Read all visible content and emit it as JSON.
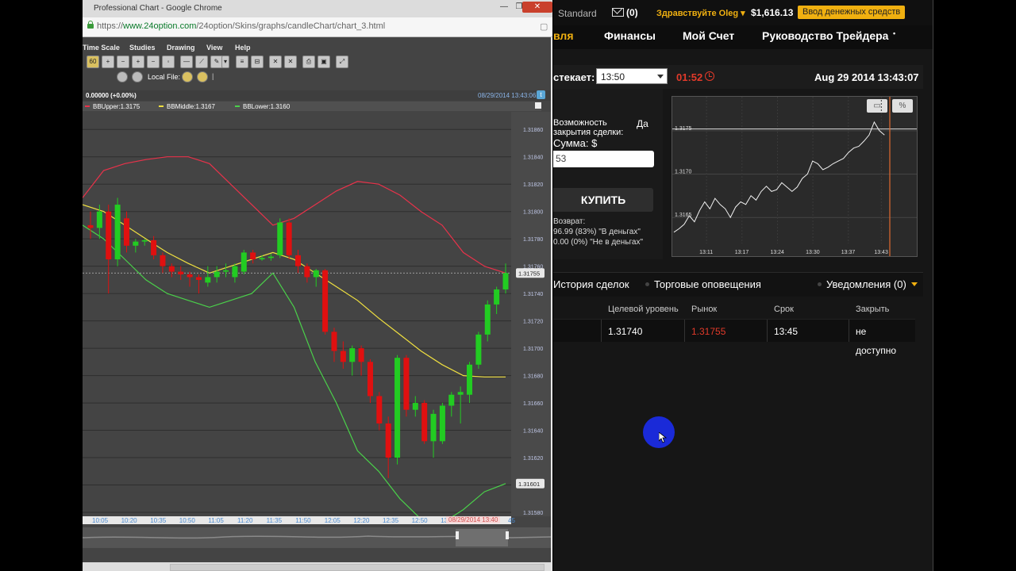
{
  "chrome": {
    "window_title": "Professional Chart - Google Chrome",
    "url_scheme": "https://",
    "url_host": "www.24option.com",
    "url_path": "/24option/Skins/graphs/candleChart/chart_3.html",
    "minimize": "—",
    "maximize": "❐",
    "close": "✕"
  },
  "chart_app": {
    "menu": [
      "Time Scale",
      "Studies",
      "Drawing",
      "View",
      "Help"
    ],
    "timeframe_button": "60",
    "local_file_label": "Local File:",
    "price_change": "0.00000 (+0.00%)",
    "timestamp": "08/29/2014 13:43:06",
    "legend": [
      {
        "label": "BBUpper:1.3175",
        "color": "#e8324a"
      },
      {
        "label": "BBMiddle:1.3167",
        "color": "#f0e040"
      },
      {
        "label": "BBLower:1.3160",
        "color": "#4ad04a"
      }
    ],
    "time_labels": [
      "10:05",
      "10:20",
      "10:35",
      "10:50",
      "11:05",
      "11:20",
      "11:35",
      "11:50",
      "12:05",
      "12:20",
      "12:35",
      "12:50",
      "13"
    ],
    "time_cursor_label": "08/29/2014 13:40",
    "time_tail": "45"
  },
  "chart_data": {
    "type": "candlestick",
    "y_tick_labels": [
      "1.31860",
      "1.31840",
      "1.31820",
      "1.31800",
      "1.31780",
      "1.31760",
      "1.31740",
      "1.31720",
      "1.31700",
      "1.31680",
      "1.31660",
      "1.31640",
      "1.31620",
      "1.31600",
      "1.31580"
    ],
    "ylim": [
      1.3158,
      1.3187
    ],
    "current_price_label": "1.31755",
    "lower_band_label": "1.31601",
    "current_price": 1.31755,
    "candles": [
      {
        "o": 1.3179,
        "h": 1.318,
        "l": 1.3178,
        "c": 1.31788
      },
      {
        "o": 1.31788,
        "h": 1.31805,
        "l": 1.3178,
        "c": 1.318
      },
      {
        "o": 1.318,
        "h": 1.31805,
        "l": 1.3174,
        "c": 1.31765
      },
      {
        "o": 1.31765,
        "h": 1.3181,
        "l": 1.3176,
        "c": 1.31805
      },
      {
        "o": 1.31795,
        "h": 1.318,
        "l": 1.3177,
        "c": 1.31775
      },
      {
        "o": 1.31775,
        "h": 1.3178,
        "l": 1.3177,
        "c": 1.31778
      },
      {
        "o": 1.31778,
        "h": 1.3178,
        "l": 1.31775,
        "c": 1.31779
      },
      {
        "o": 1.31779,
        "h": 1.31782,
        "l": 1.31765,
        "c": 1.31768
      },
      {
        "o": 1.31768,
        "h": 1.3177,
        "l": 1.31755,
        "c": 1.3176
      },
      {
        "o": 1.3176,
        "h": 1.31762,
        "l": 1.31752,
        "c": 1.31756
      },
      {
        "o": 1.31756,
        "h": 1.3176,
        "l": 1.3175,
        "c": 1.31754
      },
      {
        "o": 1.31754,
        "h": 1.31756,
        "l": 1.31745,
        "c": 1.31752
      },
      {
        "o": 1.31752,
        "h": 1.31754,
        "l": 1.3174,
        "c": 1.3175
      },
      {
        "o": 1.31748,
        "h": 1.3176,
        "l": 1.31745,
        "c": 1.31752
      },
      {
        "o": 1.31752,
        "h": 1.3176,
        "l": 1.31748,
        "c": 1.31756
      },
      {
        "o": 1.31756,
        "h": 1.31762,
        "l": 1.31752,
        "c": 1.31757
      },
      {
        "o": 1.31752,
        "h": 1.31762,
        "l": 1.31748,
        "c": 1.3176
      },
      {
        "o": 1.31756,
        "h": 1.31772,
        "l": 1.31754,
        "c": 1.3177
      },
      {
        "o": 1.3177,
        "h": 1.31772,
        "l": 1.31762,
        "c": 1.31765
      },
      {
        "o": 1.31765,
        "h": 1.31768,
        "l": 1.31764,
        "c": 1.31766
      },
      {
        "o": 1.31766,
        "h": 1.31769,
        "l": 1.31764,
        "c": 1.31767
      },
      {
        "o": 1.31768,
        "h": 1.31795,
        "l": 1.31766,
        "c": 1.31792
      },
      {
        "o": 1.31792,
        "h": 1.31795,
        "l": 1.31765,
        "c": 1.31768
      },
      {
        "o": 1.31768,
        "h": 1.31772,
        "l": 1.31755,
        "c": 1.3176
      },
      {
        "o": 1.3176,
        "h": 1.31762,
        "l": 1.31748,
        "c": 1.31752
      },
      {
        "o": 1.31752,
        "h": 1.31758,
        "l": 1.31745,
        "c": 1.31757
      },
      {
        "o": 1.31757,
        "h": 1.31758,
        "l": 1.3171,
        "c": 1.31712
      },
      {
        "o": 1.31712,
        "h": 1.31715,
        "l": 1.3169,
        "c": 1.31698
      },
      {
        "o": 1.31698,
        "h": 1.31705,
        "l": 1.31685,
        "c": 1.3169
      },
      {
        "o": 1.3169,
        "h": 1.31702,
        "l": 1.3168,
        "c": 1.317
      },
      {
        "o": 1.317,
        "h": 1.31702,
        "l": 1.3168,
        "c": 1.3169
      },
      {
        "o": 1.3169,
        "h": 1.31692,
        "l": 1.3166,
        "c": 1.31665
      },
      {
        "o": 1.31665,
        "h": 1.31668,
        "l": 1.3164,
        "c": 1.31645
      },
      {
        "o": 1.31645,
        "h": 1.3165,
        "l": 1.31605,
        "c": 1.3162
      },
      {
        "o": 1.3162,
        "h": 1.31695,
        "l": 1.31615,
        "c": 1.31693
      },
      {
        "o": 1.31693,
        "h": 1.31695,
        "l": 1.3165,
        "c": 1.31655
      },
      {
        "o": 1.31655,
        "h": 1.31665,
        "l": 1.3165,
        "c": 1.3166
      },
      {
        "o": 1.3166,
        "h": 1.31662,
        "l": 1.3163,
        "c": 1.31632
      },
      {
        "o": 1.31632,
        "h": 1.31655,
        "l": 1.3162,
        "c": 1.31652
      },
      {
        "o": 1.31632,
        "h": 1.3166,
        "l": 1.3163,
        "c": 1.31658
      },
      {
        "o": 1.31658,
        "h": 1.31668,
        "l": 1.3165,
        "c": 1.31666
      },
      {
        "o": 1.31666,
        "h": 1.31672,
        "l": 1.31645,
        "c": 1.31668
      },
      {
        "o": 1.31666,
        "h": 1.3169,
        "l": 1.3166,
        "c": 1.31688
      },
      {
        "o": 1.31688,
        "h": 1.31712,
        "l": 1.31685,
        "c": 1.3171
      },
      {
        "o": 1.3171,
        "h": 1.31735,
        "l": 1.31705,
        "c": 1.31732
      },
      {
        "o": 1.31732,
        "h": 1.31745,
        "l": 1.31725,
        "c": 1.31743
      },
      {
        "o": 1.31743,
        "h": 1.31762,
        "l": 1.3174,
        "c": 1.31755
      }
    ],
    "bb_upper": [
      1.3181,
      1.3183,
      1.31835,
      1.31838,
      1.3184,
      1.3184,
      1.31835,
      1.3182,
      1.31805,
      1.3179,
      1.31795,
      1.31805,
      1.31815,
      1.31822,
      1.3182,
      1.31812,
      1.318,
      1.3179,
      1.3177,
      1.3176,
      1.31755
    ],
    "bb_middle": [
      1.31805,
      1.318,
      1.3179,
      1.3178,
      1.3177,
      1.31762,
      1.31755,
      1.3176,
      1.31765,
      1.3177,
      1.31765,
      1.31755,
      1.31745,
      1.31735,
      1.31722,
      1.3171,
      1.31698,
      1.31688,
      1.3168,
      1.31679,
      1.31679
    ],
    "bb_lower": [
      1.3179,
      1.3178,
      1.31765,
      1.3175,
      1.3174,
      1.31735,
      1.3173,
      1.31735,
      1.3174,
      1.31755,
      1.3173,
      1.3169,
      1.3166,
      1.31625,
      1.3161,
      1.3159,
      1.31575,
      1.31572,
      1.31582,
      1.31595,
      1.31601
    ]
  },
  "platform": {
    "account_type": "Standard",
    "mail_count": "(0)",
    "greeting": "Здравствуйте Oleg",
    "balance": "$1,616.13",
    "deposit_button": "Ввод денежных средств",
    "nav": [
      "вля",
      "Финансы",
      "Мой Счет",
      "Руководство Трейдера"
    ],
    "nav_more": "•",
    "expiry_label": "стекает:",
    "expiry_value": "13:50",
    "countdown": "01:52",
    "datetime": "Aug 29 2014  13:43:07",
    "option_label_line1": "Возможность",
    "option_label_line2": "закрытия сделки:",
    "option_value": "Да",
    "sum_label": "Сумма:  $",
    "sum_value": "53",
    "buy_button": "КУПИТЬ",
    "return_label": "Возврат:",
    "return_in_money": "96.99 (83%) \"В деньгах\"",
    "return_out_money": "0.00 (0%) \"Не в деньгах\"",
    "tabs": {
      "history": "История сделок",
      "alerts": "Торговые оповещения",
      "notifications": "Уведомления (0)"
    },
    "table_headers": [
      "Целевой уровень",
      "Рынок",
      "Срок",
      "Закрыть"
    ],
    "table_row": [
      "1.31740",
      "1.31755",
      "13:45",
      "не"
    ],
    "table_row_extra": "доступно",
    "colors": {
      "accent": "#f0b010",
      "market_red": "#e23a2a"
    }
  },
  "mini_chart": {
    "type": "line",
    "y_tick_labels": [
      "1.3175",
      "1.3170",
      "1.3165"
    ],
    "ylim": [
      1.3162,
      1.3178
    ],
    "x_tick_labels": [
      "13:11",
      "13:17",
      "13:24",
      "13:30",
      "13:37",
      "13:43"
    ],
    "target_level": 1.31752,
    "values": [
      1.31633,
      1.31637,
      1.31642,
      1.31652,
      1.31645,
      1.31658,
      1.31668,
      1.3166,
      1.31672,
      1.31665,
      1.3166,
      1.3165,
      1.31662,
      1.31668,
      1.31665,
      1.31675,
      1.3167,
      1.3168,
      1.31686,
      1.3168,
      1.31682,
      1.3169,
      1.31685,
      1.3168,
      1.31685,
      1.31695,
      1.317,
      1.31715,
      1.31712,
      1.31705,
      1.31708,
      1.31712,
      1.31715,
      1.31718,
      1.31725,
      1.3173,
      1.31732,
      1.31738,
      1.31745,
      1.3176,
      1.3175,
      1.31745
    ],
    "buttons": [
      "▭",
      "%"
    ]
  }
}
